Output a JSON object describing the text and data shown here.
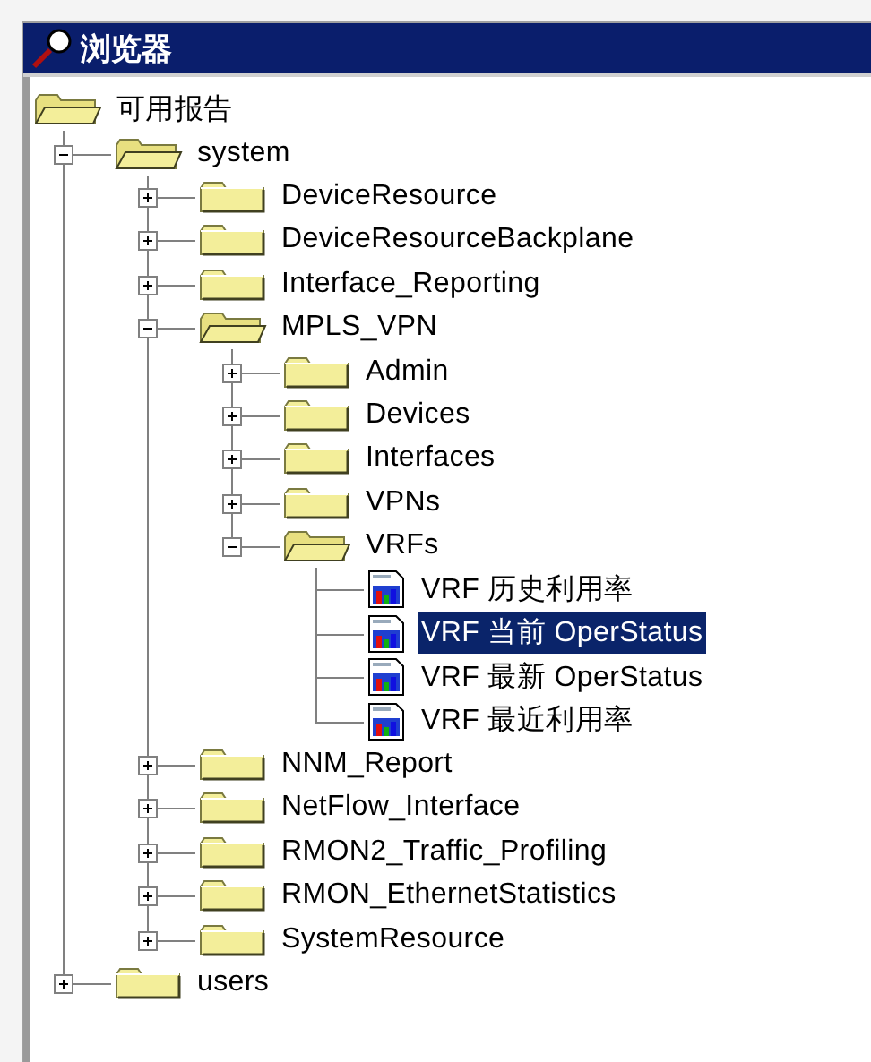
{
  "window": {
    "title": "浏览器"
  },
  "tree": [
    {
      "label": "可用报告",
      "kind": "folder",
      "selected": false,
      "expanded": true,
      "children": [
        {
          "label": "system",
          "kind": "folder",
          "selected": false,
          "expanded": true,
          "children": [
            {
              "label": "DeviceResource",
              "kind": "folder",
              "selected": false,
              "expanded": false
            },
            {
              "label": "DeviceResourceBackplane",
              "kind": "folder",
              "selected": false,
              "expanded": false
            },
            {
              "label": "Interface_Reporting",
              "kind": "folder",
              "selected": false,
              "expanded": false
            },
            {
              "label": "MPLS_VPN",
              "kind": "folder",
              "selected": false,
              "expanded": true,
              "children": [
                {
                  "label": "Admin",
                  "kind": "folder",
                  "selected": false,
                  "expanded": false
                },
                {
                  "label": "Devices",
                  "kind": "folder",
                  "selected": false,
                  "expanded": false
                },
                {
                  "label": "Interfaces",
                  "kind": "folder",
                  "selected": false,
                  "expanded": false
                },
                {
                  "label": "VPNs",
                  "kind": "folder",
                  "selected": false,
                  "expanded": false
                },
                {
                  "label": "VRFs",
                  "kind": "folder",
                  "selected": false,
                  "expanded": true,
                  "children": [
                    {
                      "label": "VRF 历史利用率",
                      "kind": "report",
                      "selected": false
                    },
                    {
                      "label": "VRF 当前 OperStatus",
                      "kind": "report",
                      "selected": true
                    },
                    {
                      "label": "VRF 最新 OperStatus",
                      "kind": "report",
                      "selected": false
                    },
                    {
                      "label": "VRF 最近利用率",
                      "kind": "report",
                      "selected": false
                    }
                  ]
                }
              ]
            },
            {
              "label": "NNM_Report",
              "kind": "folder",
              "selected": false,
              "expanded": false
            },
            {
              "label": "NetFlow_Interface",
              "kind": "folder",
              "selected": false,
              "expanded": false
            },
            {
              "label": "RMON2_Traffic_Profiling",
              "kind": "folder",
              "selected": false,
              "expanded": false
            },
            {
              "label": "RMON_EthernetStatistics",
              "kind": "folder",
              "selected": false,
              "expanded": false
            },
            {
              "label": "SystemResource",
              "kind": "folder",
              "selected": false,
              "expanded": false
            }
          ]
        },
        {
          "label": "users",
          "kind": "folder",
          "selected": false,
          "expanded": false
        }
      ]
    }
  ]
}
